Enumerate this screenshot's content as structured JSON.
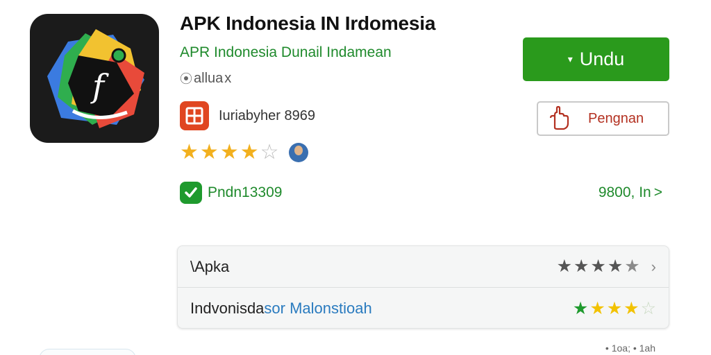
{
  "app": {
    "title": "APK Indonesia IN Irdomesia",
    "developer": "APR Indonesia Dunail Indamean",
    "tag": "allua",
    "tag_mark": "x"
  },
  "badge": {
    "text": "Iuriabyher  8969"
  },
  "rating": {
    "filled": 4,
    "total": 5
  },
  "verification": {
    "text": "Pndn13309"
  },
  "size_link": {
    "text": "9800, In",
    "chevron": ">"
  },
  "actions": {
    "download_label": "Undu",
    "download_icon": "down-arrow-icon",
    "secondary_label": "Pengnan",
    "secondary_icon": "hand-icon"
  },
  "info_card": {
    "rows": [
      {
        "label": "\\Apka",
        "label_highlight": "",
        "stars": "★★★★★",
        "star_color": "#555555"
      },
      {
        "label": "Indvonisda",
        "label_highlight": "sor Malonstioah",
        "stars": "★★★★☆",
        "star_colors": [
          "#1f9a2e",
          "#f2c200",
          "#c8d8c0"
        ]
      }
    ]
  },
  "footer": {
    "text": "• 1oa; • 1ah"
  },
  "colors": {
    "accent": "#2a9a1c",
    "brand_text": "#1f8a2c",
    "star": "#f2b01e",
    "badge": "#e04621"
  }
}
